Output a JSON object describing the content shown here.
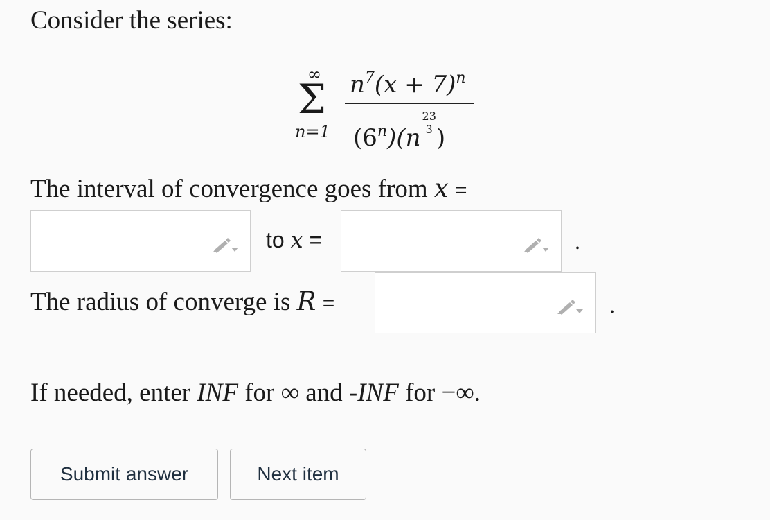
{
  "heading": "Consider the series:",
  "series": {
    "upper": "∞",
    "sigma": "Σ",
    "lower": "n=1",
    "num_base": "n",
    "num_exp": "7",
    "num_paren": "(x + 7)",
    "num_paren_exp": "n",
    "den_open": "(6",
    "den_exp": "n",
    "den_mid": ")(n",
    "den_frac_top": "23",
    "den_frac_bottom": "3",
    "den_close": ")"
  },
  "interval": {
    "prefix": "The interval of convergence goes from",
    "var": "x",
    "eq": "=",
    "to_word": "to",
    "to_var": "x",
    "to_eq": "=",
    "period": "."
  },
  "radius": {
    "prefix": "The radius of converge is",
    "var": "R",
    "eq": "=",
    "period": "."
  },
  "hint": {
    "p1": "If needed, enter",
    "inf": "INF",
    "p2": "for ∞ and -",
    "neg_inf": "INF",
    "p3": "for −∞."
  },
  "buttons": {
    "submit": "Submit answer",
    "next": "Next item"
  },
  "colors": {
    "box_border": "#cfcfcf",
    "pencil": "#b0b0b0"
  }
}
